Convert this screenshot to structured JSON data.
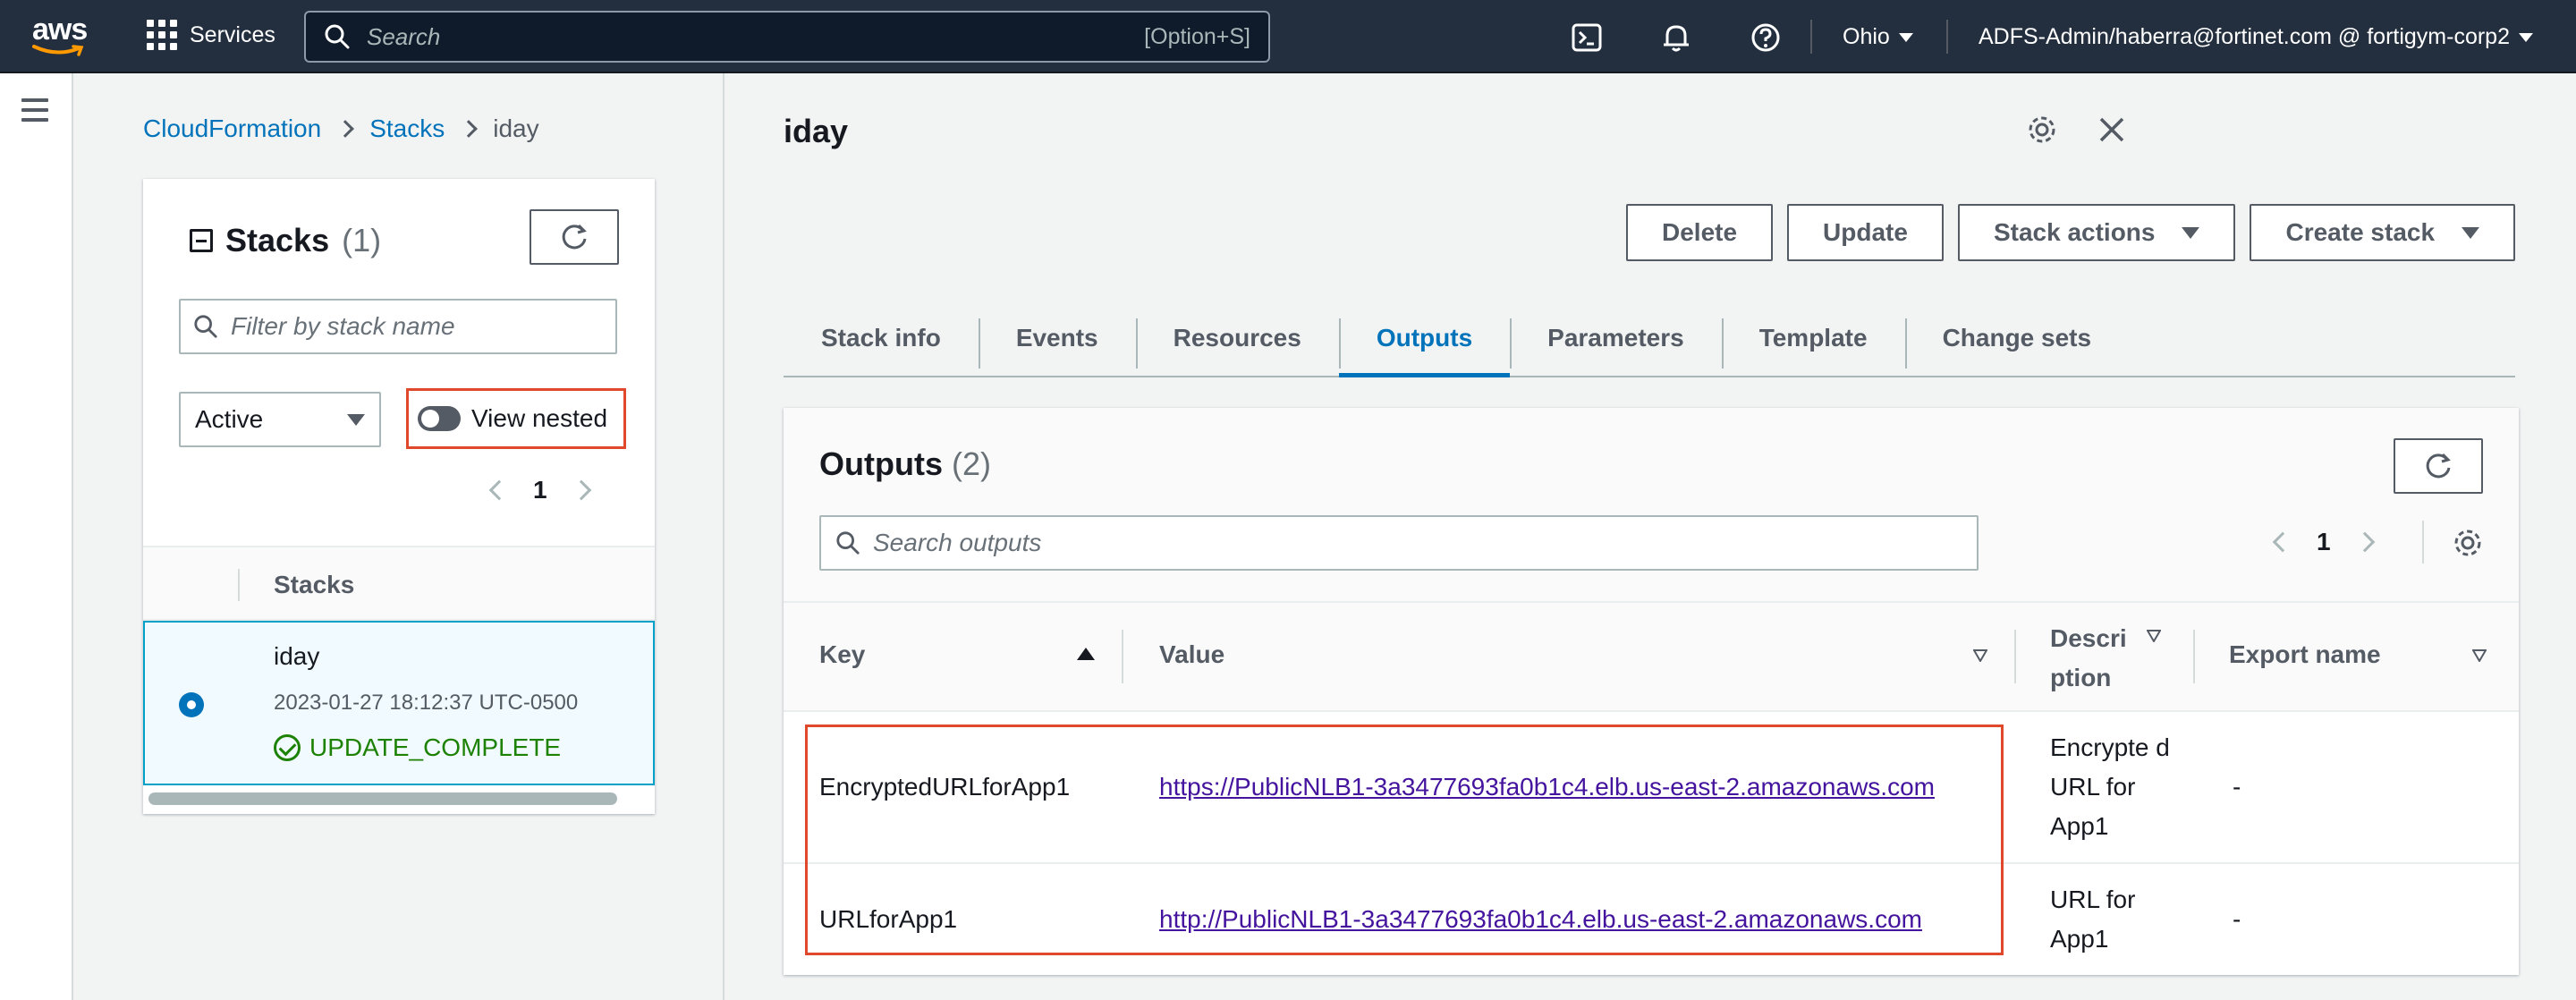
{
  "topnav": {
    "logo_text": "aws",
    "services_label": "Services",
    "search_placeholder": "Search",
    "search_hint": "[Option+S]",
    "region": "Ohio",
    "account": "ADFS-Admin/haberra@fortinet.com @ fortigym-corp2",
    "icons": [
      "cloudshell-icon",
      "notifications-bell-icon",
      "help-icon"
    ]
  },
  "breadcrumb": {
    "items": [
      "CloudFormation",
      "Stacks"
    ],
    "current": "iday"
  },
  "stacks_panel": {
    "title": "Stacks",
    "count": "(1)",
    "filter_placeholder": "Filter by stack name",
    "status_filter": "Active",
    "view_nested_label": "View nested",
    "view_nested_on": false,
    "page": "1",
    "column_header": "Stacks",
    "rows": [
      {
        "name": "iday",
        "created": "2023-01-27 18:12:37 UTC-0500",
        "status": "UPDATE_COMPLETE",
        "selected": true
      }
    ]
  },
  "detail": {
    "title": "iday",
    "buttons": {
      "delete": "Delete",
      "update": "Update",
      "stack_actions": "Stack actions",
      "create_stack": "Create stack"
    },
    "tabs": [
      "Stack info",
      "Events",
      "Resources",
      "Outputs",
      "Parameters",
      "Template",
      "Change sets"
    ],
    "active_tab": "Outputs"
  },
  "outputs": {
    "title": "Outputs",
    "count": "(2)",
    "search_placeholder": "Search outputs",
    "page": "1",
    "columns": {
      "key": "Key",
      "value": "Value",
      "description": "Descri ption",
      "export": "Export name"
    },
    "rows": [
      {
        "key": "EncryptedURLforApp1",
        "value": "https://PublicNLB1-3a3477693fa0b1c4.elb.us-east-2.amazonaws.com",
        "description": "Encrypte d URL for App1",
        "export": "-"
      },
      {
        "key": "URLforApp1",
        "value": "http://PublicNLB1-3a3477693fa0b1c4.elb.us-east-2.amazonaws.com",
        "description": "URL for App1",
        "export": "-"
      }
    ]
  },
  "colors": {
    "nav_bg": "#232f3e",
    "link": "#0073bb",
    "visited_link": "#44149e",
    "success": "#1d8102",
    "highlight_box": "#e0482b"
  }
}
